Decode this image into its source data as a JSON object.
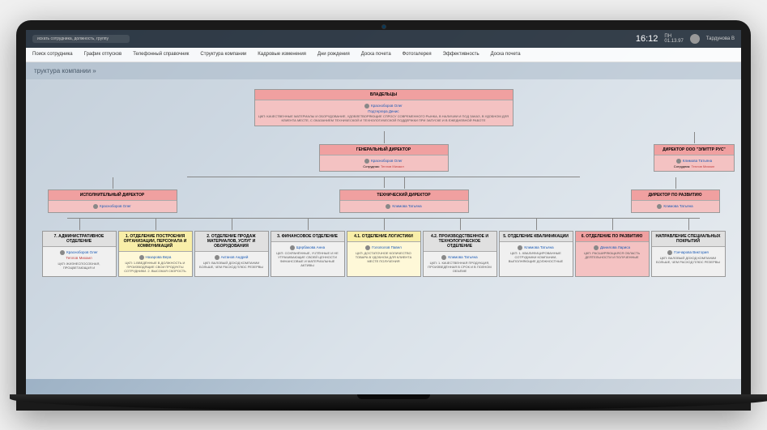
{
  "topbar": {
    "search_placeholder": "искать сотрудника, должность, группу",
    "clock": "16:12",
    "day": "ПН",
    "date": "01.13.97",
    "user_name": "Тардунова В"
  },
  "menu": {
    "items": [
      "Поиск сотрудника",
      "График отпусков",
      "Телефонный справочник",
      "Структура компании",
      "Кадровые изменения",
      "Дни рождения",
      "Доска почета",
      "Фотогалерея",
      "Эффективность",
      "Доска почета"
    ]
  },
  "page": {
    "title": "труктура компании »"
  },
  "org": {
    "owners": {
      "title": "ВЛАДЕЛЬЦЫ",
      "person1": "Красноборов Олег",
      "person2": "Подтергера Денис",
      "desc": "ЦКП: КАЧЕСТВЕННЫЕ МАТЕРИАЛЫ И ОБОРУДОВАНИЕ, УДОВЛЕТВОРЯЮЩИЕ СПРОСУ СОВРЕМЕННОГО РЫНКА, В НАЛИЧИИ И ПОД ЗАКАЗ, В УДОБНОМ ДЛЯ КЛИЕНТА МЕСТЕ, С ОКАЗАНИЕМ ТЕХНИЧЕСКОЙ И ТЕХНОЛОГИЧЕСКОЙ ПОДДЕРЖКИ ПРИ ЗАПУСКЕ И В ЕЖЕДНЕВНОЙ РАБОТЕ"
    },
    "ceo": {
      "title": "ГЕНЕРАЛЬНЫЙ ДИРЕКТОР",
      "person": "Красноборов Олег",
      "staff_label": "Сотрудник:",
      "staff": "Теплов Михаил"
    },
    "director_rus": {
      "title": "ДИРЕКТОР ООО \"ЭлитТр РУС\"",
      "person": "Климова Татьяна",
      "staff_label": "Сотрудник:",
      "staff": "Теплов Михаил"
    },
    "exec": {
      "title": "ИСПОЛНИТЕЛЬНЫЙ ДИРЕКТОР",
      "person": "Красноборов Олег"
    },
    "tech": {
      "title": "ТЕХНИЧЕСКИЙ ДИРЕКТОР",
      "person": "Климова Татьяна"
    },
    "dev": {
      "title": "ДИРЕКТОР ПО РАЗВИТИЮ",
      "person": "Климова Татьяна"
    },
    "depts": [
      {
        "title": "7. АДМИНИСТРАТИВНОЕ ОТДЕЛЕНИЕ",
        "person": "Красноборов Олег",
        "sub": "Теплов Михаил",
        "desc": "ЦКП: ЖИЗНЕСПОСОБНАЯ, ПРОЦВЕТАЮЩАЯ И",
        "color": "gray"
      },
      {
        "title": "1. ОТДЕЛЕНИЕ ПОСТРОЕНИЯ ОРГАНИЗАЦИИ, ПЕРСОНАЛА И КОММУНИКАЦИЙ",
        "person": "Назарова Вера",
        "desc": "ЦКП: 1.ВВЕДЁННЫЕ В ДОЛЖНОСТЬ И ПРОИЗВОДЯЩИЕ СВОИ ПРОДУКТЫ СОТРУДНИКИ. 2. ВЫСОКАЯ СКОРОСТЬ",
        "color": "yellow"
      },
      {
        "title": "2. ОТДЕЛЕНИЕ ПРОДАЖ МАТЕРИАЛОВ, УСЛУГ И ОБОРУДОВАНИЯ",
        "person": "Актанов Андрей",
        "desc": "ЦКП: ВАЛОВЫЙ ДОХОД КОМПАНИИ БОЛЬШЕ, ЧЕМ РАСХОД ПЛЮС РЕЗЕРВЫ",
        "color": "gray"
      },
      {
        "title": "3. ФИНАНСОВОЕ ОТДЕЛЕНИЕ",
        "person": "Щербакова Анна",
        "desc": "ЦКП: СОХРАНЁННЫЕ, УЧТЁННЫЕ И НЕ УТРАЧИВАЮЩИЕ СВОЕЙ ЦЕННОСТИ ФИНАНСОВЫЕ И МАТЕРИАЛЬНЫЕ АКТИВЫ",
        "color": "gray"
      },
      {
        "title": "4.1. ОТДЕЛЕНИЕ ЛОГИСТИКИ",
        "person": "Голополов Павел",
        "desc": "ЦКП: ДОСТАТОЧНОЕ КОЛИЧЕСТВО ТОВАРА В УДОБНОМ ДЛЯ КЛИЕНТА МЕСТЕ ПОЛУЧЕНИЯ",
        "color": "yellow"
      },
      {
        "title": "4.2. ПРОИЗВОДСТВЕННОЕ И ТЕХНОЛОГИЧЕСКОЕ ОТДЕЛЕНИЕ",
        "person": "Климова Татьяна",
        "desc": "ЦКП: 1. КАЧЕСТВЕННАЯ ПРОДУКЦИЯ, ПРОИЗВЕДЁННАЯ В СРОК И В ПОЛНОМ ОБЪЁМЕ",
        "color": "gray"
      },
      {
        "title": "5. ОТДЕЛЕНИЕ КВАЛИФИКАЦИИ",
        "person": "Климова Татьяна",
        "desc": "ЦКП: 1. КВАЛИФИЦИРОВАННЫЕ СОТРУДНИКИ КОМПАНИИ, ВЫПОЛНЯЮЩИЕ ДОЛЖНОСТНЫЕ",
        "color": "gray"
      },
      {
        "title": "6. ОТДЕЛЕНИЕ ПО РАЗВИТИЮ",
        "person": "Данилова Лариса",
        "desc": "ЦКП: РАСШИРЯЮЩАЯСЯ ОБЛАСТЬ ДЕЯТЕЛЬНОСТИ И ПОЛУЧЕННЫЕ",
        "color": "pink"
      },
      {
        "title": "НАПРАВЛЕНИЕ СПЕЦИАЛЬНЫХ ПОКРЫТИЙ",
        "person": "Гончарова Виктория",
        "desc": "ЦКП: ВАЛОВЫЙ ДОХОД КОМПАНИИ БОЛЬШЕ, ЧЕМ РАСХОД ПЛЮС РЕЗЕРВЫ",
        "color": "gray"
      }
    ]
  }
}
